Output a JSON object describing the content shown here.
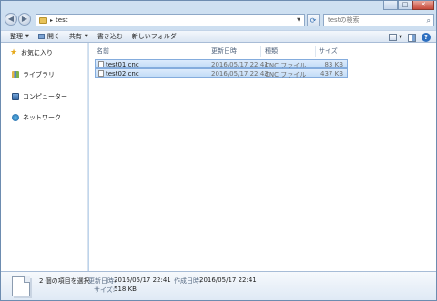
{
  "window": {
    "caption_buttons": {
      "minimize": "–",
      "maximize": "□",
      "close": "✕"
    }
  },
  "navigation": {
    "back_glyph": "◀",
    "forward_glyph": "▶",
    "address": {
      "breadcrumb_separator": "▸",
      "folder": "test"
    },
    "refresh_glyph": "⟳",
    "search": {
      "placeholder": "testの検索",
      "icon": "magnifier-icon"
    }
  },
  "toolbar": {
    "organize": "整理",
    "open": "開く",
    "share": "共有",
    "burn": "書き込む",
    "new_folder": "新しいフォルダー",
    "dropdown_glyph": "▼",
    "help_glyph": "?"
  },
  "nav_pane": {
    "items": [
      {
        "label": "お気に入り",
        "icon": "star-icon"
      },
      {
        "label": "ライブラリ",
        "icon": "library-icon"
      },
      {
        "label": "コンピューター",
        "icon": "computer-icon"
      },
      {
        "label": "ネットワーク",
        "icon": "network-icon"
      }
    ]
  },
  "file_list": {
    "columns": [
      "名前",
      "更新日時",
      "種類",
      "サイズ"
    ],
    "rows": [
      {
        "name": "test01.cnc",
        "modified": "2016/05/17 22:41",
        "type": "CNC ファイル",
        "size": "83 KB"
      },
      {
        "name": "test02.cnc",
        "modified": "2016/05/17 22:43",
        "type": "CNC ファイル",
        "size": "437 KB"
      }
    ]
  },
  "details_pane": {
    "selection": "2 個の項目を選択",
    "modified_label": "更新日時:",
    "modified_value": "2016/05/17 22:41",
    "created_label": "作成日時:",
    "created_value": "2016/05/17 22:41",
    "size_label": "サイズ:",
    "size_value": "518 KB"
  },
  "colors": {
    "selection_fill": "#c8dff8",
    "selection_border": "#84acdd",
    "frame": "#b9d1ea"
  }
}
